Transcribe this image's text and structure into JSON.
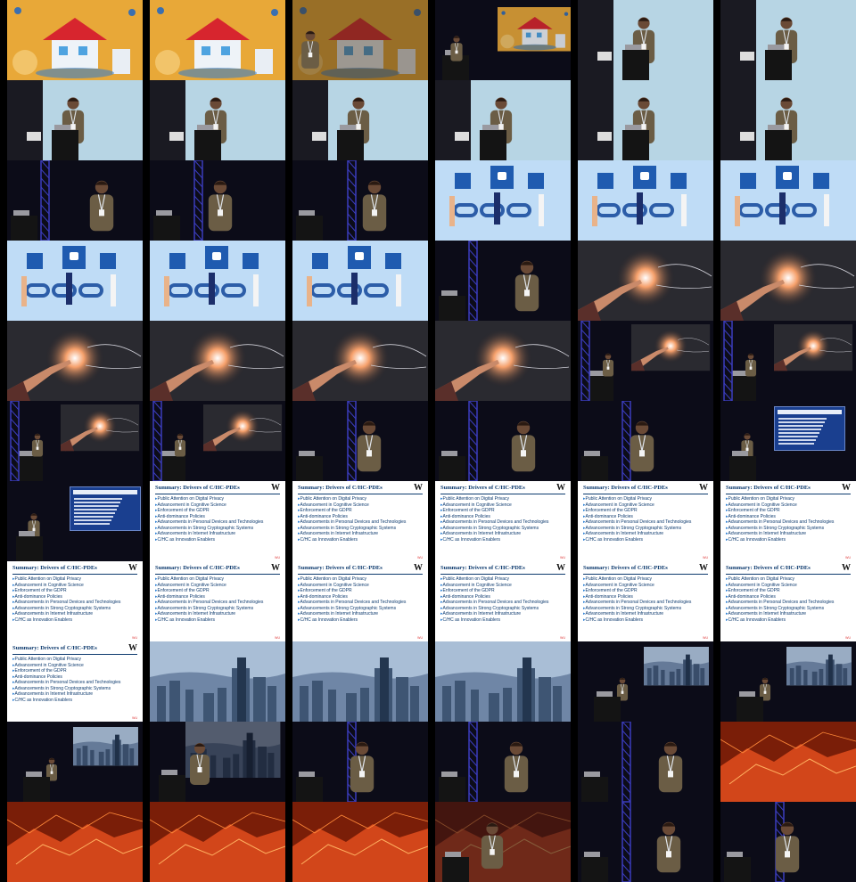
{
  "slide": {
    "title": "Summary: Drivers of C/HC-PDEs",
    "logo": "W",
    "bullets": [
      "Public Attention on Digital Privacy",
      "Advancement in Cognitive Science",
      "Enforcement of the GDPR",
      "Anti-dominance Policies",
      "Advancements in Personal Devices and Technologies",
      "Advancements in Strong Cryptographic Systems",
      "Advancements in Internet Infrastructure",
      "C/HC as Innovation Enablers"
    ],
    "footer_logo": "WU"
  },
  "palette": {
    "house": "#e8a838",
    "chain": "#7db9ea",
    "hand": "#1c2a5a",
    "city": "#8aa3c0",
    "fire": "#d2461a",
    "stage": "#0c0c18",
    "truss": "#3b3dbd"
  },
  "frames": [
    {
      "kind": "house"
    },
    {
      "kind": "house"
    },
    {
      "kind": "house-fade"
    },
    {
      "kind": "stage-house"
    },
    {
      "kind": "speaker-house"
    },
    {
      "kind": "speaker-house"
    },
    {
      "kind": "speaker-house"
    },
    {
      "kind": "speaker-house"
    },
    {
      "kind": "speaker-house"
    },
    {
      "kind": "speaker-house"
    },
    {
      "kind": "speaker-house"
    },
    {
      "kind": "speaker-house"
    },
    {
      "kind": "speaker-dark"
    },
    {
      "kind": "speaker-dark"
    },
    {
      "kind": "speaker-dark"
    },
    {
      "kind": "chain"
    },
    {
      "kind": "chain"
    },
    {
      "kind": "chain"
    },
    {
      "kind": "chain"
    },
    {
      "kind": "chain"
    },
    {
      "kind": "chain"
    },
    {
      "kind": "speaker-dark"
    },
    {
      "kind": "hand"
    },
    {
      "kind": "hand"
    },
    {
      "kind": "hand"
    },
    {
      "kind": "hand"
    },
    {
      "kind": "hand"
    },
    {
      "kind": "hand"
    },
    {
      "kind": "stage-hand"
    },
    {
      "kind": "stage-hand"
    },
    {
      "kind": "stage-hand"
    },
    {
      "kind": "stage-hand"
    },
    {
      "kind": "speaker-dark"
    },
    {
      "kind": "speaker-dark"
    },
    {
      "kind": "speaker-dark"
    },
    {
      "kind": "stage-mini"
    },
    {
      "kind": "stage-mini"
    },
    {
      "kind": "slide"
    },
    {
      "kind": "slide"
    },
    {
      "kind": "slide"
    },
    {
      "kind": "slide"
    },
    {
      "kind": "slide"
    },
    {
      "kind": "slide"
    },
    {
      "kind": "slide"
    },
    {
      "kind": "slide"
    },
    {
      "kind": "slide"
    },
    {
      "kind": "slide"
    },
    {
      "kind": "slide"
    },
    {
      "kind": "slide"
    },
    {
      "kind": "city"
    },
    {
      "kind": "city"
    },
    {
      "kind": "city"
    },
    {
      "kind": "stage-city"
    },
    {
      "kind": "stage-city"
    },
    {
      "kind": "stage-city"
    },
    {
      "kind": "speaker-city"
    },
    {
      "kind": "speaker-dark"
    },
    {
      "kind": "speaker-dark"
    },
    {
      "kind": "speaker-dark"
    },
    {
      "kind": "fire"
    },
    {
      "kind": "fire"
    },
    {
      "kind": "fire"
    },
    {
      "kind": "fire"
    },
    {
      "kind": "speaker-fire"
    },
    {
      "kind": "speaker-dark"
    },
    {
      "kind": "speaker-dark"
    }
  ]
}
